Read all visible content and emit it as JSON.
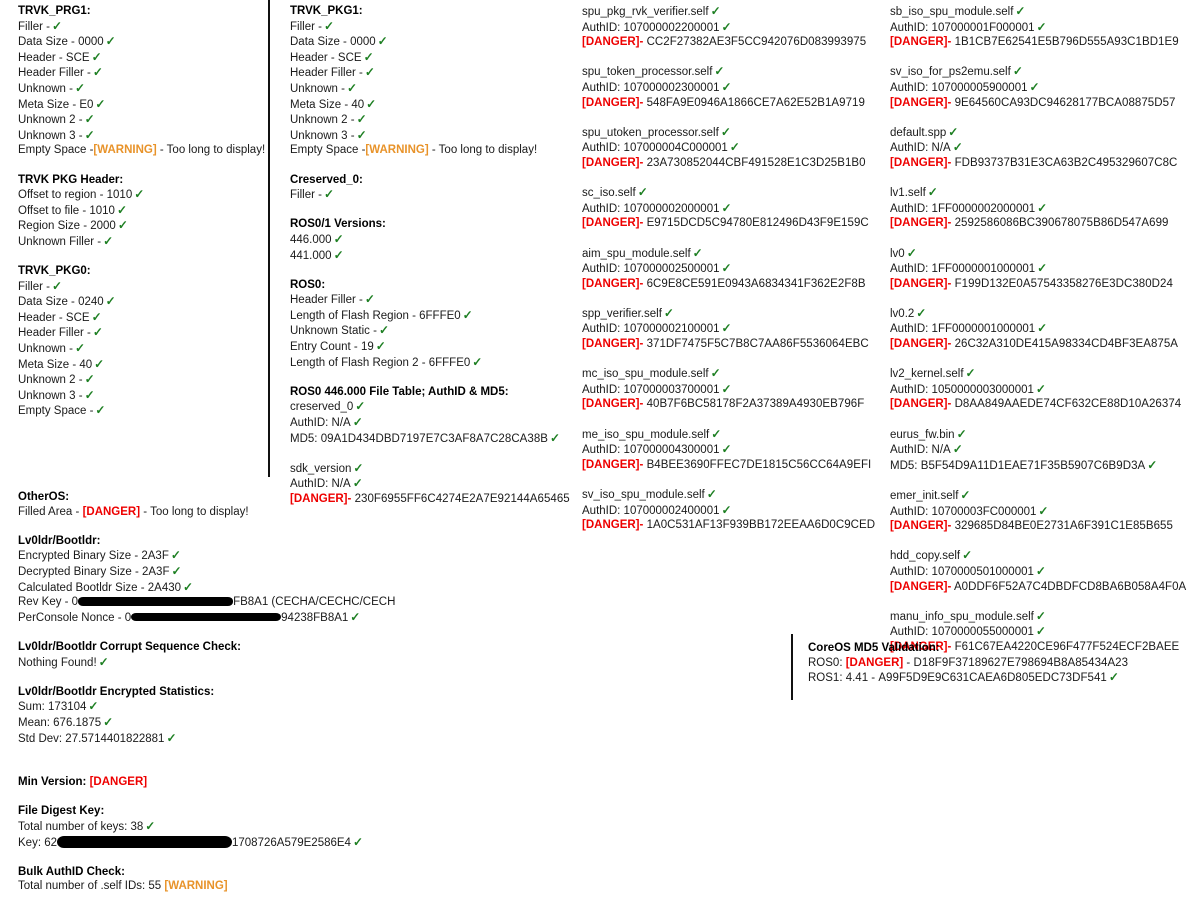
{
  "glyphs": {
    "check": "✓",
    "danger": "[DANGER]",
    "warning": "[WARNING]"
  },
  "column1": {
    "trvk_prg1": {
      "title": "TRVK_PRG1:",
      "rows": [
        {
          "label": "Filler -",
          "status": "ok"
        },
        {
          "label": "Data Size - 0000",
          "status": "ok"
        },
        {
          "label": "Header - SCE",
          "status": "ok"
        },
        {
          "label": "Header Filler -",
          "status": "ok"
        },
        {
          "label": "Unknown -",
          "status": "ok"
        },
        {
          "label": "Meta Size - E0",
          "status": "ok"
        },
        {
          "label": "Unknown 2 -",
          "status": "ok"
        },
        {
          "label": "Unknown 3 -",
          "status": "ok"
        },
        {
          "label": "Empty Space -",
          "status": "warning",
          "suffix": "- Too long to display!"
        }
      ]
    },
    "trvk_pkg_header": {
      "title": "TRVK PKG Header:",
      "rows": [
        {
          "label": "Offset to region - 1010",
          "status": "ok"
        },
        {
          "label": "Offset to file - 1010",
          "status": "ok"
        },
        {
          "label": "Region Size - 2000",
          "status": "ok"
        },
        {
          "label": "Unknown Filler -",
          "status": "ok"
        }
      ]
    },
    "trvk_pkg0": {
      "title": "TRVK_PKG0:",
      "rows": [
        {
          "label": "Filler -",
          "status": "ok"
        },
        {
          "label": "Data Size - 0240",
          "status": "ok"
        },
        {
          "label": "Header - SCE",
          "status": "ok"
        },
        {
          "label": "Header Filler -",
          "status": "ok"
        },
        {
          "label": "Unknown -",
          "status": "ok"
        },
        {
          "label": "Meta Size - 40",
          "status": "ok"
        },
        {
          "label": "Unknown 2 -",
          "status": "ok"
        },
        {
          "label": "Unknown 3 -",
          "status": "ok"
        },
        {
          "label": "Empty Space -",
          "status": "ok"
        }
      ]
    }
  },
  "column2": {
    "trvk_pkg1": {
      "title": "TRVK_PKG1:",
      "rows": [
        {
          "label": "Filler -",
          "status": "ok"
        },
        {
          "label": "Data Size - 0000",
          "status": "ok"
        },
        {
          "label": "Header - SCE",
          "status": "ok"
        },
        {
          "label": "Header Filler -",
          "status": "ok"
        },
        {
          "label": "Unknown -",
          "status": "ok"
        },
        {
          "label": "Meta Size - 40",
          "status": "ok"
        },
        {
          "label": "Unknown 2 -",
          "status": "ok"
        },
        {
          "label": "Unknown 3 -",
          "status": "ok"
        },
        {
          "label": "Empty Space -",
          "status": "warning",
          "suffix": "- Too long to display!"
        }
      ]
    },
    "creserved_0": {
      "title": "Creserved_0:",
      "rows": [
        {
          "label": "Filler -",
          "status": "ok"
        }
      ]
    },
    "ros_versions": {
      "title": "ROS0/1 Versions:",
      "rows": [
        {
          "label": "446.000",
          "status": "ok"
        },
        {
          "label": "441.000",
          "status": "ok"
        }
      ]
    },
    "ros0": {
      "title": "ROS0:",
      "rows": [
        {
          "label": "Header Filler -",
          "status": "ok"
        },
        {
          "label": "Length of Flash Region - 6FFFE0",
          "status": "ok"
        },
        {
          "label": "Unknown Static -",
          "status": "ok"
        },
        {
          "label": "Entry Count - 19",
          "status": "ok"
        },
        {
          "label": "Length of Flash Region 2 - 6FFFE0",
          "status": "ok"
        }
      ]
    },
    "ros0_file_table": {
      "title": "ROS0 446.000 File Table; AuthID & MD5:",
      "entries": [
        {
          "name": "creserved_0",
          "name_status": "ok",
          "authid": "AuthID: N/A",
          "authid_status": "ok",
          "hash_label": "MD5:",
          "hash": "09A1D434DBD7197E7C3AF8A7C28CA38B",
          "hash_status": "ok"
        },
        {
          "name": "sdk_version",
          "name_status": "ok",
          "authid": "AuthID: N/A",
          "authid_status": "ok",
          "hash_label": "[DANGER]-",
          "hash": "230F6955FF6C4274E2A7E92144A65465",
          "hash_status": "danger"
        }
      ]
    }
  },
  "column3": {
    "entries": [
      {
        "name": "spu_pkg_rvk_verifier.self",
        "authid": "AuthID: 107000002200001",
        "hash": "CC2F27382AE3F5CC942076D083993975"
      },
      {
        "name": "spu_token_processor.self",
        "authid": "AuthID: 107000002300001",
        "hash": "548FA9E0946A1866CE7A62E52B1A9719"
      },
      {
        "name": "spu_utoken_processor.self",
        "authid": "AuthID: 107000004C000001",
        "hash": "23A730852044CBF491528E1C3D25B1B0"
      },
      {
        "name": "sc_iso.self",
        "authid": "AuthID: 107000002000001",
        "hash": "E9715DCD5C94780E812496D43F9E159C"
      },
      {
        "name": "aim_spu_module.self",
        "authid": "AuthID: 107000002500001",
        "hash": "6C9E8CE591E0943A6834341F362E2F8B"
      },
      {
        "name": "spp_verifier.self",
        "authid": "AuthID: 107000002100001",
        "hash": "371DF7475F5C7B8C7AA86F5536064EBC"
      },
      {
        "name": "mc_iso_spu_module.self",
        "authid": "AuthID: 107000003700001",
        "hash": "40B7F6BC58178F2A37389A4930EB796F"
      },
      {
        "name": "me_iso_spu_module.self",
        "authid": "AuthID: 107000004300001",
        "hash": "B4BEE3690FFEC7DE1815C56CC64A9EFI"
      },
      {
        "name": "sv_iso_spu_module.self",
        "authid": "AuthID: 107000002400001",
        "hash": "1A0C531AF13F939BB172EEAA6D0C9CED"
      }
    ]
  },
  "column4": {
    "entries": [
      {
        "name": "sb_iso_spu_module.self",
        "authid": "AuthID: 107000001F000001",
        "hash_label": "[DANGER]-",
        "hash": "1B1CB7E62541E5B796D555A93C1BD1E9",
        "hash_status": "danger"
      },
      {
        "name": "sv_iso_for_ps2emu.self",
        "authid": "AuthID: 107000005900001",
        "hash_label": "[DANGER]-",
        "hash": "9E64560CA93DC94628177BCA08875D57",
        "hash_status": "danger"
      },
      {
        "name": "default.spp",
        "authid": "AuthID: N/A",
        "hash_label": "[DANGER]-",
        "hash": "FDB93737B31E3CA63B2C495329607C8C",
        "hash_status": "danger"
      },
      {
        "name": "lv1.self",
        "authid": "AuthID: 1FF0000002000001",
        "hash_label": "[DANGER]-",
        "hash": "2592586086BC390678075B86D547A699",
        "hash_status": "danger"
      },
      {
        "name": "lv0",
        "authid": "AuthID: 1FF0000001000001",
        "hash_label": "[DANGER]-",
        "hash": "F199D132E0A57543358276E3DC380D24",
        "hash_status": "danger"
      },
      {
        "name": "lv0.2",
        "authid": "AuthID: 1FF0000001000001",
        "hash_label": "[DANGER]-",
        "hash": "26C32A310DE415A98334CD4BF3EA875A",
        "hash_status": "danger"
      },
      {
        "name": "lv2_kernel.self",
        "authid": "AuthID: 1050000003000001",
        "hash_label": "[DANGER]-",
        "hash": "D8AA849AAEDE74CF632CE88D10A26374",
        "hash_status": "danger"
      },
      {
        "name": "eurus_fw.bin",
        "authid": "AuthID: N/A",
        "hash_label": "MD5:",
        "hash": "B5F54D9A11D1EAE71F35B5907C6B9D3A",
        "hash_status": "ok"
      },
      {
        "name": "emer_init.self",
        "authid": "AuthID: 10700003FC000001",
        "hash_label": "[DANGER]-",
        "hash": "329685D84BE0E2731A6F391C1E85B655",
        "hash_status": "danger"
      },
      {
        "name": "hdd_copy.self",
        "authid": "AuthID: 1070000501000001",
        "hash_label": "[DANGER]-",
        "hash": "A0DDF6F52A7C4DBDFCD8BA6B058A4F0A",
        "hash_status": "danger"
      },
      {
        "name": "manu_info_spu_module.self",
        "authid": "AuthID: 1070000055000001",
        "hash_label": "[DANGER]-",
        "hash": "F61C67EA4220CE96F477F524ECF2BAEE",
        "hash_status": "danger"
      }
    ]
  },
  "lower_left": {
    "otheros": {
      "title": "OtherOS:",
      "filled_area_prefix": "Filled Area -",
      "filled_area_status": "[DANGER]",
      "filled_area_suffix": "- Too long to display!"
    },
    "lv0ldr": {
      "title": "Lv0ldr/Bootldr:",
      "rows": [
        {
          "label": "Encrypted Binary Size - 2A3F",
          "status": "ok"
        },
        {
          "label": "Decrypted Binary Size - 2A3F",
          "status": "ok"
        },
        {
          "label": "Calculated Bootldr Size - 2A430",
          "status": "ok"
        }
      ],
      "rev_key_prefix": "Rev Key - 0",
      "rev_key_suffix": "FB8A1 (CECHA/CECHC/CECH",
      "per_console_prefix": "PerConsole Nonce - 0",
      "per_console_suffix": "94238FB8A1",
      "per_console_status": "ok"
    },
    "corrupt_check": {
      "title": "Lv0ldr/Bootldr Corrupt Sequence Check:",
      "result": "Nothing Found!",
      "result_status": "ok"
    },
    "stats": {
      "title": "Lv0ldr/Bootldr Encrypted Statistics:",
      "rows": [
        {
          "label": "Sum: 173104",
          "status": "ok"
        },
        {
          "label": "Mean: 676.1875",
          "status": "ok"
        },
        {
          "label": "Std Dev: 27.5714401822881",
          "status": "ok"
        }
      ]
    },
    "min_version": {
      "title": "Min Version:",
      "status": "[DANGER]"
    },
    "file_digest_key": {
      "title": "File Digest Key:",
      "total_label": "Total number of keys: 38",
      "total_status": "ok",
      "key_prefix": "Key: 62",
      "key_suffix": "1708726A579E2586E4",
      "key_status": "ok"
    },
    "bulk_authid": {
      "title": "Bulk AuthID Check:",
      "total_label": "Total number of .self IDs: 55",
      "total_status": "[WARNING]"
    }
  },
  "coreos": {
    "title": "CoreOS MD5 Validation:",
    "ros0_prefix": "ROS0:",
    "ros0_status": "[DANGER]",
    "ros0_hash": "- D18F9F37189627E798694B8A85434A23",
    "ros1_prefix": "ROS1: 4.41 -",
    "ros1_hash": "A99F5D9E9C631CAEA6D805EDC73DF541",
    "ros1_status": "ok"
  }
}
